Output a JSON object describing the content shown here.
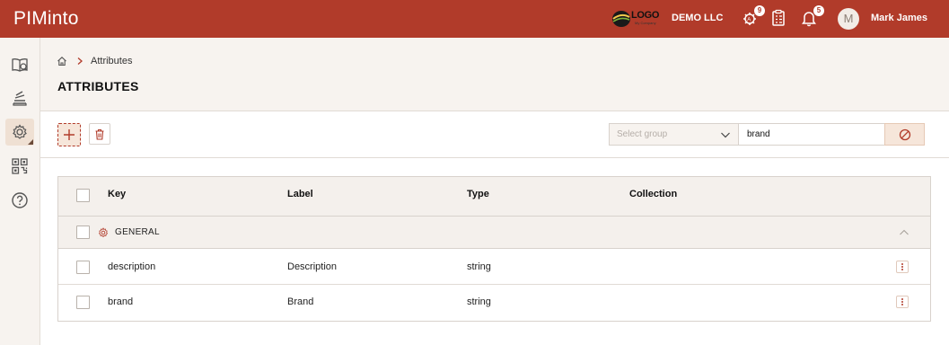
{
  "app": {
    "title": "PIMinto"
  },
  "header": {
    "logo_text": "LOGO",
    "logo_subtext": "My Company",
    "company_name": "DEMO LLC",
    "tasks_badge": "9",
    "notifications_badge": "5",
    "avatar_initial": "M",
    "user_name": "Mark James"
  },
  "sidebar": {
    "items": [
      {
        "icon": "catalog-icon"
      },
      {
        "icon": "books-icon"
      },
      {
        "icon": "gear-icon",
        "active": true
      },
      {
        "icon": "qr-code-icon"
      },
      {
        "icon": "help-icon"
      }
    ]
  },
  "breadcrumb": {
    "current": "Attributes"
  },
  "page": {
    "title": "ATTRIBUTES"
  },
  "toolbar": {
    "group_select_placeholder": "Select group",
    "search_value": "brand"
  },
  "table": {
    "columns": [
      "Key",
      "Label",
      "Type",
      "Collection"
    ],
    "group": {
      "label": "GENERAL",
      "expanded": true
    },
    "rows": [
      {
        "key": "description",
        "label": "Description",
        "type": "string",
        "collection": ""
      },
      {
        "key": "brand",
        "label": "Brand",
        "type": "string",
        "collection": ""
      }
    ]
  },
  "colors": {
    "brand": "#b13b2a",
    "panel": "#f7f3ef",
    "accent_light": "#f6e6da"
  }
}
